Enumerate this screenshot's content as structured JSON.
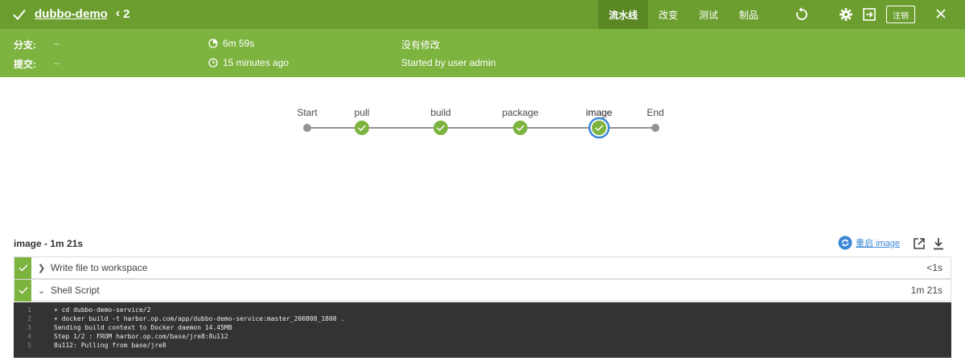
{
  "header": {
    "job_name": "dubbo-demo",
    "run_number": "2",
    "tabs": [
      {
        "label": "流水线",
        "active": true
      },
      {
        "label": "改变",
        "active": false
      },
      {
        "label": "测试",
        "active": false
      },
      {
        "label": "制品",
        "active": false
      }
    ],
    "logout_label": "注销"
  },
  "summary": {
    "branch_label": "分支:",
    "branch_value": "–",
    "commit_label": "提交:",
    "commit_value": "–",
    "duration": "6m 59s",
    "started": "15 minutes ago",
    "changes": "没有修改",
    "started_by": "Started by user admin"
  },
  "pipeline": {
    "stages": [
      "Start",
      "pull",
      "build",
      "package",
      "image",
      "End"
    ],
    "selected": "image"
  },
  "step_panel": {
    "title_stage": "image",
    "title_duration": " - 1m 21s",
    "restart_label": "重启 image",
    "steps": [
      {
        "name": "Write file to workspace",
        "duration": "<1s",
        "expanded": false
      },
      {
        "name": "Shell Script",
        "duration": "1m 21s",
        "expanded": true
      }
    ],
    "log": [
      {
        "n": "1",
        "text": "+ cd dubbo-demo-service/2"
      },
      {
        "n": "2",
        "text": "+ docker build -t harbor.op.com/app/dubbo-demo-service:master_200808_1800 ."
      },
      {
        "n": "3",
        "text": "Sending build context to Docker daemon  14.45MB"
      },
      {
        "n": "4",
        "text": "Step 1/2 : FROM harbor.op.com/base/jre8:8u112"
      },
      {
        "n": "5",
        "text": "8u112: Pulling from base/jre8"
      }
    ]
  },
  "colors": {
    "header_green": "#6b9e2e",
    "summary_green": "#7db33f",
    "success": "#7db33f",
    "selected_ring": "#3a86d6",
    "log_bg": "#333333"
  }
}
